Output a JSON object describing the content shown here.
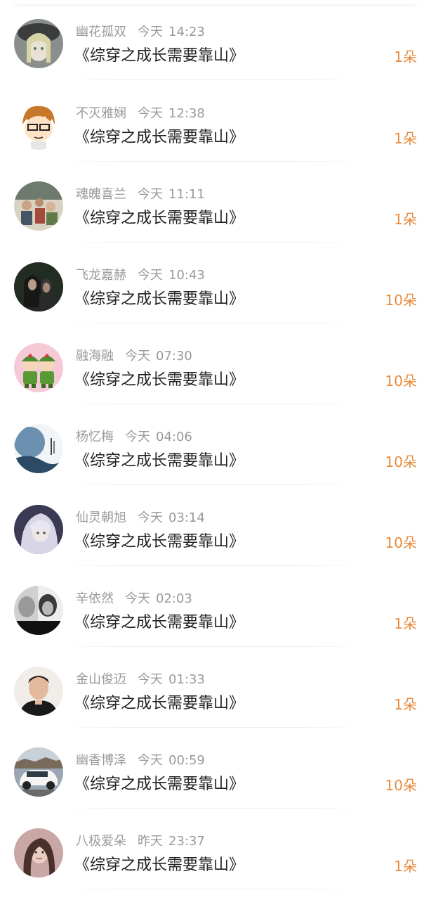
{
  "colors": {
    "accent": "#e98a3c",
    "meta_text": "#9a9a9a",
    "title_text": "#222222"
  },
  "gifts": [
    {
      "name": "幽花孤双",
      "day": "今天",
      "time": "14:23",
      "title": "《综穿之成长需要靠山》",
      "amount": "1朵",
      "avatar": "anime-girl-avatar"
    },
    {
      "name": "不灭雅娴",
      "day": "今天",
      "time": "12:38",
      "title": "《综穿之成长需要靠山》",
      "amount": "1朵",
      "avatar": "cartoon-boy-glasses-avatar"
    },
    {
      "name": "魂魄喜兰",
      "day": "今天",
      "time": "11:11",
      "title": "《综穿之成长需要靠山》",
      "amount": "1朵",
      "avatar": "group-photo-avatar"
    },
    {
      "name": "飞龙嘉赫",
      "day": "今天",
      "time": "10:43",
      "title": "《综穿之成长需要靠山》",
      "amount": "10朵",
      "avatar": "dark-couple-photo-avatar"
    },
    {
      "name": "融海融",
      "day": "今天",
      "time": "07:30",
      "title": "《综穿之成长需要靠山》",
      "amount": "10朵",
      "avatar": "cartoon-soldiers-avatar"
    },
    {
      "name": "杨忆梅",
      "day": "今天",
      "time": "04:06",
      "title": "《综穿之成长需要靠山》",
      "amount": "10朵",
      "avatar": "moon-landscape-avatar"
    },
    {
      "name": "仙灵朝旭",
      "day": "今天",
      "time": "03:14",
      "title": "《综穿之成长需要靠山》",
      "amount": "10朵",
      "avatar": "white-hair-anime-avatar"
    },
    {
      "name": "辛依然",
      "day": "今天",
      "time": "02:03",
      "title": "《综穿之成长需要靠山》",
      "amount": "1朵",
      "avatar": "black-white-photo-avatar"
    },
    {
      "name": "金山俊迈",
      "day": "今天",
      "time": "01:33",
      "title": "《综穿之成长需要靠山》",
      "amount": "1朵",
      "avatar": "man-portrait-avatar"
    },
    {
      "name": "幽香博泽",
      "day": "今天",
      "time": "00:59",
      "title": "《综穿之成长需要靠山》",
      "amount": "10朵",
      "avatar": "white-car-avatar"
    },
    {
      "name": "八极爱朵",
      "day": "昨天",
      "time": "23:37",
      "title": "《综穿之成长需要靠山》",
      "amount": "1朵",
      "avatar": "girl-portrait-avatar"
    }
  ]
}
